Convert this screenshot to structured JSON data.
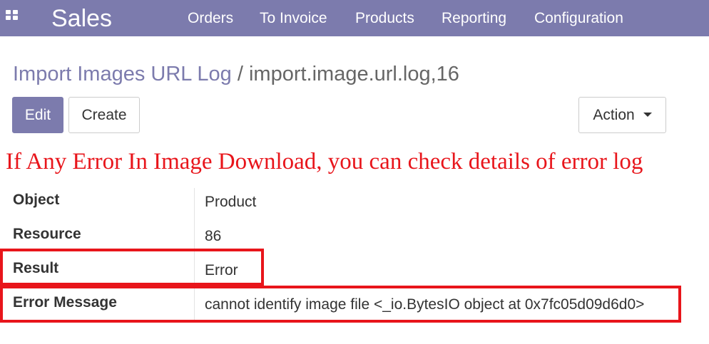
{
  "navbar": {
    "brand": "Sales",
    "menu": [
      "Orders",
      "To Invoice",
      "Products",
      "Reporting",
      "Configuration"
    ],
    "color": "#7c7bad",
    "apps_icon": "apps-grid-icon"
  },
  "breadcrumb": {
    "parent": "Import Images URL Log",
    "separator": "/",
    "current": "import.image.url.log,16"
  },
  "buttons": {
    "edit": "Edit",
    "create": "Create",
    "action": "Action",
    "action_icon": "caret-down-icon"
  },
  "annotation": "If Any Error In Image Download, you can check details of error log",
  "annotation_color": "#e8151b",
  "fields": [
    {
      "label": "Object",
      "value": "Product"
    },
    {
      "label": "Resource",
      "value": "86"
    },
    {
      "label": "Result",
      "value": "Error"
    },
    {
      "label": "Error Message",
      "value": "cannot identify image file <_io.BytesIO object at 0x7fc05d09d6d0>"
    }
  ]
}
